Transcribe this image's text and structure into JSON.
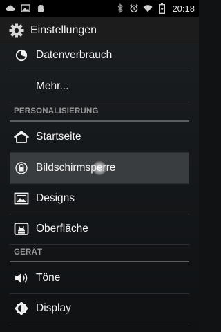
{
  "status_bar": {
    "time": "20:18",
    "left_icons": [
      "cloud-icon",
      "image-icon",
      "android-icon"
    ],
    "right_icons": [
      "bluetooth-icon",
      "alarm-icon",
      "wifi-icon",
      "battery-icon"
    ]
  },
  "action_bar": {
    "title": "Einstellungen",
    "icon": "gear-icon"
  },
  "colors": {
    "background": "#101214",
    "selected_row": "#3a3d40",
    "section_header": "#9a9a9a"
  },
  "list": {
    "items": [
      {
        "label": "Datenverbrauch",
        "icon": "data-usage-icon"
      },
      {
        "label": "Mehr...",
        "icon": ""
      }
    ],
    "sections": [
      {
        "header": "PERSONALISIERUNG",
        "items": [
          {
            "label": "Startseite",
            "icon": "home-icon"
          },
          {
            "label": "Bildschirmsperre",
            "icon": "lock-icon",
            "selected": true
          },
          {
            "label": "Designs",
            "icon": "image-icon"
          },
          {
            "label": "Oberfläche",
            "icon": "android-icon"
          }
        ]
      },
      {
        "header": "GERÄT",
        "items": [
          {
            "label": "Töne",
            "icon": "volume-icon"
          },
          {
            "label": "Display",
            "icon": "brightness-icon"
          }
        ]
      }
    ]
  }
}
